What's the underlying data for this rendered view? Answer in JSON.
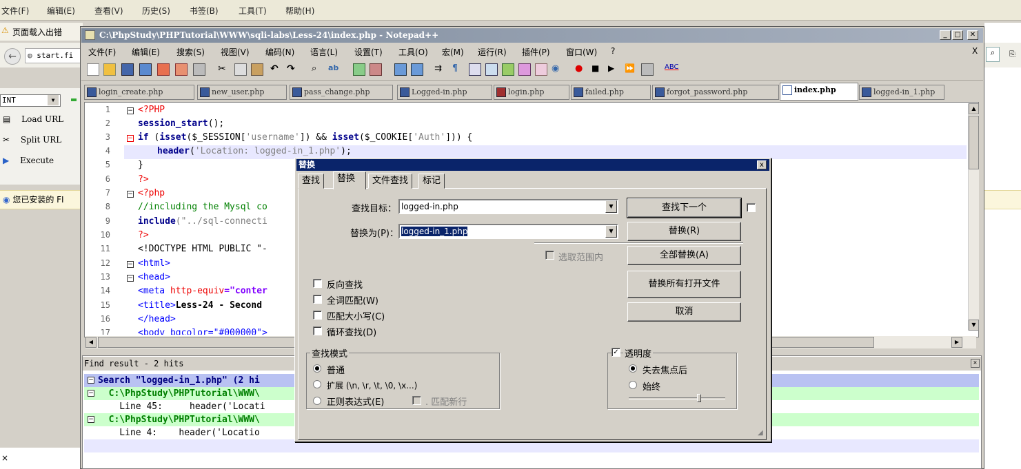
{
  "browser": {
    "menu": [
      "文件(F)",
      "编辑(E)",
      "查看(V)",
      "历史(S)",
      "书签(B)",
      "工具(T)",
      "帮助(H)"
    ],
    "notification": "页面载入出错",
    "url": "start.fi",
    "hackbar": {
      "select_value": "INT",
      "load_url": "Load URL",
      "split_url": "Split URL",
      "execute": "Execute"
    },
    "info_bar": "您已安装的 FI"
  },
  "npp": {
    "title": "C:\\PhpStudy\\PHPTutorial\\WWW\\sqli-labs\\Less-24\\index.php - Notepad++",
    "menu": [
      "文件(F)",
      "编辑(E)",
      "搜索(S)",
      "视图(V)",
      "编码(N)",
      "语言(L)",
      "设置(T)",
      "工具(O)",
      "宏(M)",
      "运行(R)",
      "插件(P)",
      "窗口(W)",
      "?"
    ],
    "menu_x": "X",
    "tabs": [
      "login_create.php",
      "new_user.php",
      "pass_change.php",
      "Logged-in.php",
      "login.php",
      "failed.php",
      "forgot_password.php",
      "index.php",
      "logged-in_1.php"
    ],
    "active_tab": "index.php",
    "line_numbers": [
      "1",
      "2",
      "3",
      "4",
      "5",
      "6",
      "7",
      "8",
      "9",
      "10",
      "11",
      "12",
      "13",
      "14",
      "15",
      "16",
      "17"
    ],
    "code": {
      "l1": "<?PHP",
      "l2a": "session_start",
      "l2b": "();",
      "l3a": "if",
      "l3b": " (",
      "l3c": "isset",
      "l3d": "($_SESSION[",
      "l3e": "'username'",
      "l3f": "]) && ",
      "l3g": "isset",
      "l3h": "($_COOKIE[",
      "l3i": "'Auth'",
      "l3j": "])) {",
      "l4a": "header",
      "l4b": "(",
      "l4c": "'Location: logged-in_1.php'",
      "l4d": ");",
      "l5": "}",
      "l6": "?>",
      "l7": "<?php",
      "l8": "//including the Mysql co",
      "l9a": "include",
      "l9b": "(\"../sql-connecti",
      "l10": "?>",
      "l11": "<!DOCTYPE HTML PUBLIC \"-",
      "l12": "<html>",
      "l13": "<head>",
      "l14a": "<meta ",
      "l14b": "http-equiv",
      "l14c": "=\"conter",
      "l15a": "<title>",
      "l15b": "Less-24 - Second",
      "l16": "</head>",
      "l17": "<body bgcolor=\"#000000\">"
    },
    "find_result": {
      "header": "Find result - 2 hits",
      "search_line": "Search \"logged-in_1.php\" (2 hi",
      "file1": "  C:\\PhpStudy\\PHPTutorial\\WWW\\",
      "hit1": "    Line 45:     header('Locati",
      "file2": "  C:\\PhpStudy\\PHPTutorial\\WWW\\",
      "hit2": "    Line 4:    header('Locatio"
    }
  },
  "dialog": {
    "title": "替换",
    "close": "x",
    "tabs": [
      "查找",
      "替换",
      "文件查找",
      "标记"
    ],
    "find_label": "查找目标：",
    "find_value": "logged-in.php",
    "replace_label": "替换为(P)：",
    "replace_value": "logged-in_1.php",
    "buttons": {
      "find_next": "查找下一个",
      "replace": "替换(R)",
      "replace_all": "全部替换(A)",
      "replace_all_open": "替换所有打开文件",
      "cancel": "取消"
    },
    "in_selection": "选取范围内",
    "options": [
      "反向查找",
      "全词匹配(W)",
      "匹配大小写(C)",
      "循环查找(D)"
    ],
    "search_mode": {
      "label": "查找模式",
      "normal": "普通",
      "extended": "扩展 (\\n, \\r, \\t, \\0, \\x...)",
      "regex": "正则表达式(E)",
      "dot_newline": ". 匹配新行"
    },
    "transparency": {
      "label": "透明度",
      "on_lose_focus": "失去焦点后",
      "always": "始终"
    }
  }
}
